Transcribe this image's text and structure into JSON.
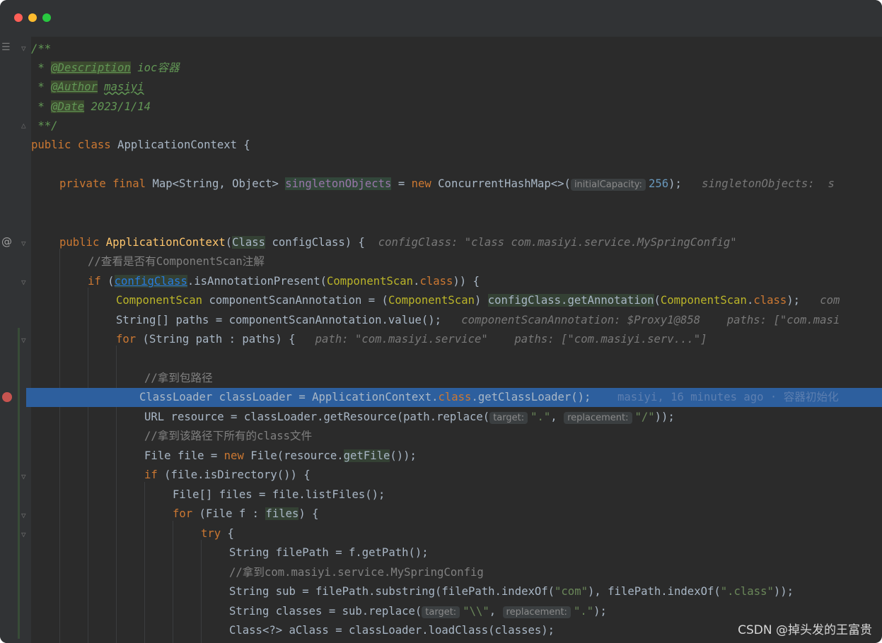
{
  "lines": {
    "l1": "/**",
    "l2_star": " * ",
    "l2_tag": "@Description",
    "l2_text": " ioc容器",
    "l3_star": " * ",
    "l3_tag": "@Author",
    "l3_text": "masiyi",
    "l4_star": " * ",
    "l4_tag": "@Date",
    "l4_text": " 2023/1/14",
    "l5": " **/",
    "l6_kw": "public class",
    "l6_rest": " ApplicationContext {",
    "l8_kw": "private final",
    "l8_a": " Map<String, Object> ",
    "l8_field": "singletonObjects",
    "l8_b": " = ",
    "l8_new": "new",
    "l8_c": " ConcurrentHashMap<>(",
    "l8_hint": "initialCapacity:",
    "l8_num": "256",
    "l8_d": ");",
    "l8_inlay": "singletonObjects:  s",
    "l11_kw": "public",
    "l11_method": "ApplicationContext",
    "l11_a": "(",
    "l11_class": "Class",
    "l11_b": " configClass) {",
    "l11_inlay": "configClass: \"class com.masiyi.service.MySpringConfig\"",
    "l12": "//查看是否有ComponentScan注解",
    "l13_kw": "if",
    "l13_a": " (",
    "l13_link": "configClass",
    "l13_b": ".isAnnotationPresent(",
    "l13_ann": "ComponentScan",
    "l13_c": ".",
    "l13_cls": "class",
    "l13_d": ")) {",
    "l14_ann": "ComponentScan",
    "l14_a": " componentScanAnnotation = (",
    "l14_ann2": "ComponentScan",
    "l14_b": ") ",
    "l14_hl": "configClass.getAnnotation",
    "l14_c": "(",
    "l14_ann3": "ComponentScan",
    "l14_d": ".",
    "l14_cls": "class",
    "l14_e": ");",
    "l14_inlay": "com",
    "l15_a": "String[] paths = componentScanAnnotation.value();",
    "l15_inlay": "componentScanAnnotation: $Proxy1@858    paths: [\"com.masi",
    "l16_kw": "for",
    "l16_a": " (String path : paths) {",
    "l16_inlay": "path: \"com.masiyi.service\"    paths: [\"com.masiyi.serv...\"]",
    "l18": "//拿到包路径",
    "l19_a": "ClassLoader classLoader = ApplicationContext.",
    "l19_cls": "class",
    "l19_b": ".getClassLoader();",
    "l19_blame": "masiyi, 16 minutes ago · 容器初始化",
    "l20_a": "URL resource = classLoader.getResource(path.replace(",
    "l20_hint1": "target:",
    "l20_str1": "\".\"",
    "l20_b": ", ",
    "l20_hint2": "replacement:",
    "l20_str2": "\"/\"",
    "l20_c": "));",
    "l21": "//拿到该路径下所有的class文件",
    "l22_a": "File file = ",
    "l22_new": "new",
    "l22_b": " File(resource.",
    "l22_hl": "getFile",
    "l22_c": "());",
    "l23_kw": "if",
    "l23_a": " (file.isDirectory()) {",
    "l24": "File[] files = file.listFiles();",
    "l25_kw": "for",
    "l25_a": " (File f : ",
    "l25_hl": "files",
    "l25_b": ") {",
    "l26_kw": "try",
    "l26_a": " {",
    "l27": "String filePath = f.getPath();",
    "l28": "//拿到com.masiyi.service.MySpringConfig",
    "l29_a": "String sub = filePath.substring(filePath.indexOf(",
    "l29_str1": "\"com\"",
    "l29_b": "), filePath.indexOf(",
    "l29_str2": "\".class\"",
    "l29_c": "));",
    "l30_a": "String classes = sub.replace(",
    "l30_hint1": "target:",
    "l30_str1": "\"\\\\\"",
    "l30_b": ", ",
    "l30_hint2": "replacement:",
    "l30_str2": "\".\"",
    "l30_c": ");",
    "l31": "Class<?> aClass = classLoader.loadClass(classes);"
  },
  "watermark": "CSDN @掉头发的王富贵",
  "colors": {
    "background": "#2b2b2b",
    "gutter": "#313335",
    "current_line": "#2d5f9e",
    "keyword": "#cc7832",
    "string": "#6a8759"
  }
}
